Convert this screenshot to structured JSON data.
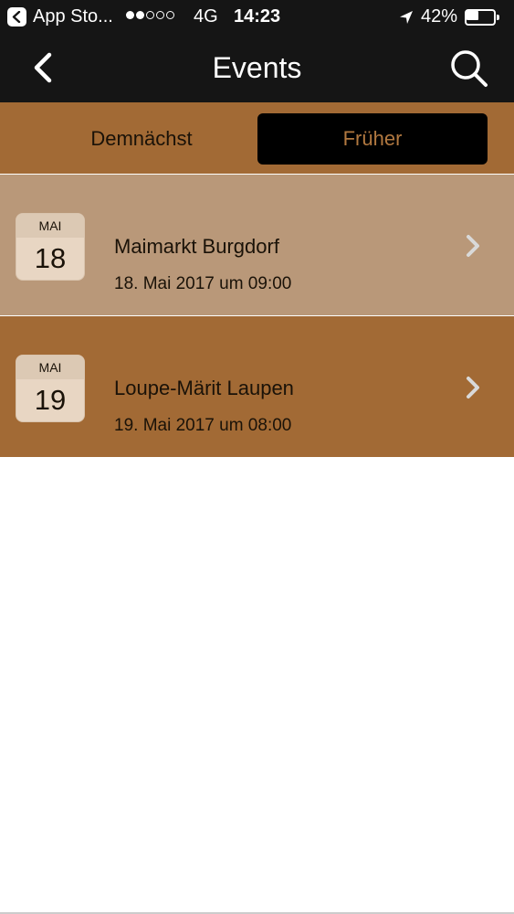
{
  "status_bar": {
    "back_app": "App Sto...",
    "signal_dots_filled": 2,
    "signal_dots_total": 5,
    "network": "4G",
    "time": "14:23",
    "battery_percent": "42%",
    "battery_level": 0.42
  },
  "nav": {
    "title": "Events",
    "back_icon": "chevron-left-icon",
    "search_icon": "search-icon"
  },
  "tabs": [
    {
      "label": "Demnächst",
      "selected": false
    },
    {
      "label": "Früher",
      "selected": true
    }
  ],
  "events": [
    {
      "month": "MAI",
      "day": "18",
      "title": "Maimarkt Burgdorf",
      "datetime": "18. Mai 2017 um 09:00"
    },
    {
      "month": "MAI",
      "day": "19",
      "title": "Loupe-Märit Laupen",
      "datetime": "19. Mai 2017 um 08:00"
    }
  ],
  "colors": {
    "bar_dark": "#151515",
    "accent_brown": "#a26a35",
    "row_highlight": "#b99879",
    "selected_tab_text": "#b17840"
  }
}
